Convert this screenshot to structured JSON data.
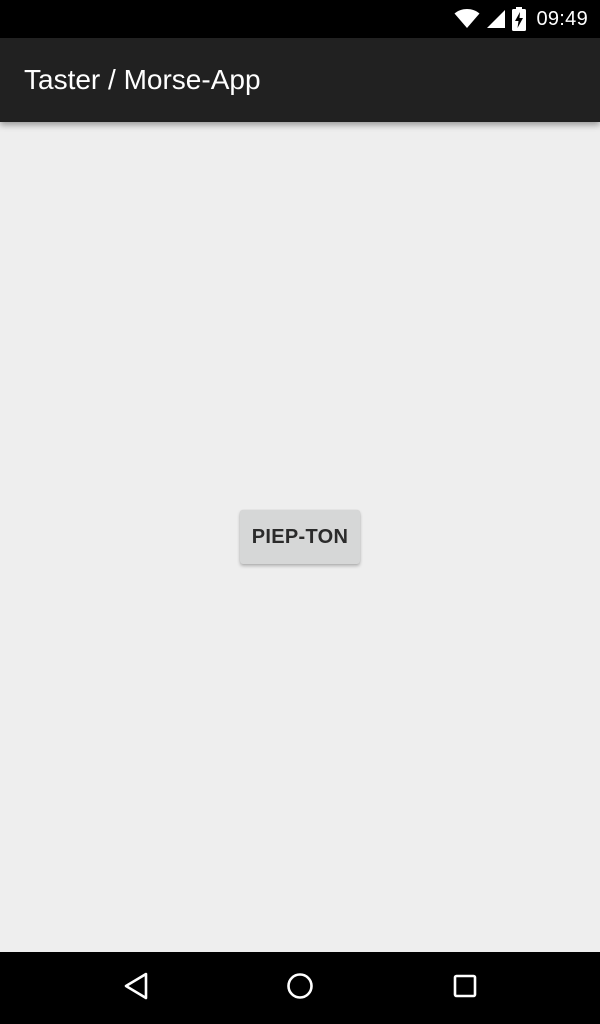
{
  "status_bar": {
    "time": "09:49",
    "icons": [
      "wifi-icon",
      "cell-signal-icon",
      "battery-charging-icon"
    ]
  },
  "app_bar": {
    "title": "Taster / Morse-App",
    "background_color": "#212121"
  },
  "content": {
    "beep_button_label": "PIEP-TON",
    "background_color": "#eeeeee"
  },
  "nav_bar": {
    "buttons": [
      "back-icon",
      "home-icon",
      "recent-apps-icon"
    ]
  }
}
